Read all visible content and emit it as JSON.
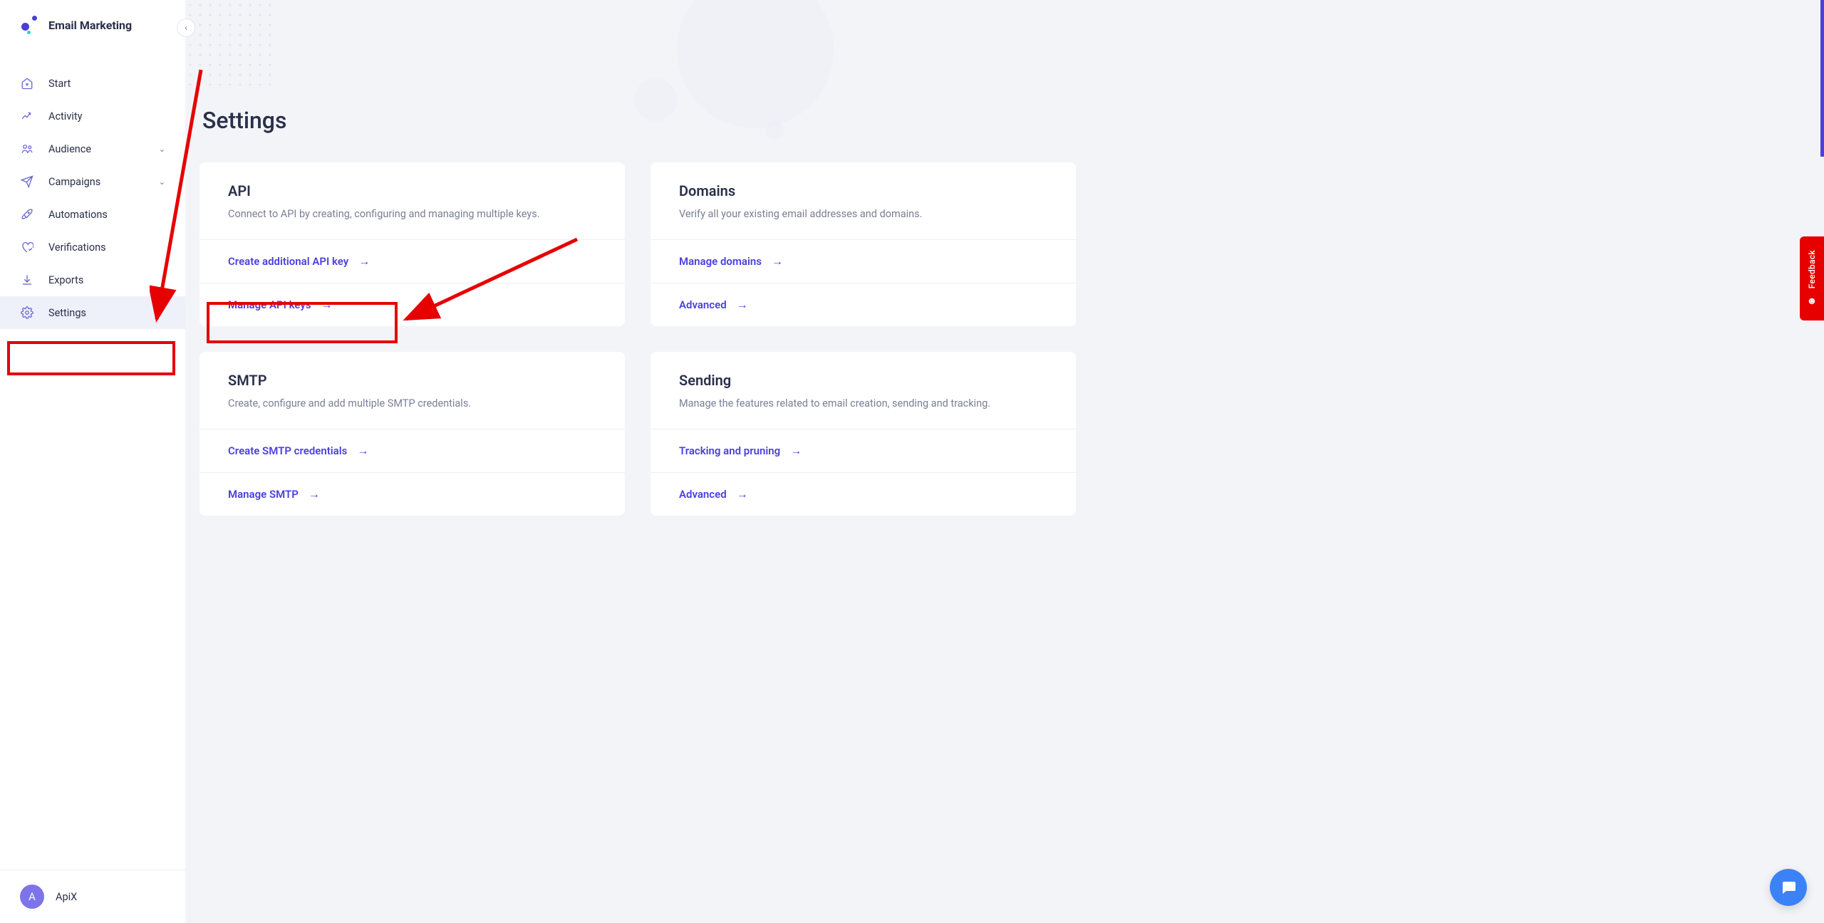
{
  "app_title": "Email Marketing",
  "page_title": "Settings",
  "sidebar": {
    "items": [
      {
        "label": "Start",
        "icon": "home-icon",
        "expandable": false
      },
      {
        "label": "Activity",
        "icon": "chart-icon",
        "expandable": false
      },
      {
        "label": "Audience",
        "icon": "people-icon",
        "expandable": true
      },
      {
        "label": "Campaigns",
        "icon": "send-icon",
        "expandable": true
      },
      {
        "label": "Automations",
        "icon": "rocket-icon",
        "expandable": false
      },
      {
        "label": "Verifications",
        "icon": "heart-check-icon",
        "expandable": false
      },
      {
        "label": "Exports",
        "icon": "download-icon",
        "expandable": false
      },
      {
        "label": "Settings",
        "icon": "gear-icon",
        "expandable": false,
        "active": true
      }
    ]
  },
  "user": {
    "avatar_letter": "A",
    "name": "ApiX"
  },
  "cards": [
    {
      "title": "API",
      "desc": "Connect to API by creating, configuring and managing multiple keys.",
      "links": [
        {
          "label": "Create additional API key"
        },
        {
          "label": "Manage API keys"
        }
      ]
    },
    {
      "title": "Domains",
      "desc": "Verify all your existing email addresses and domains.",
      "links": [
        {
          "label": "Manage domains"
        },
        {
          "label": "Advanced"
        }
      ]
    },
    {
      "title": "SMTP",
      "desc": "Create, configure and add multiple SMTP credentials.",
      "links": [
        {
          "label": "Create SMTP credentials"
        },
        {
          "label": "Manage SMTP"
        }
      ]
    },
    {
      "title": "Sending",
      "desc": "Manage the features related to email creation, sending and tracking.",
      "links": [
        {
          "label": "Tracking and pruning"
        },
        {
          "label": "Advanced"
        }
      ]
    }
  ],
  "feedback_label": "Feedback"
}
